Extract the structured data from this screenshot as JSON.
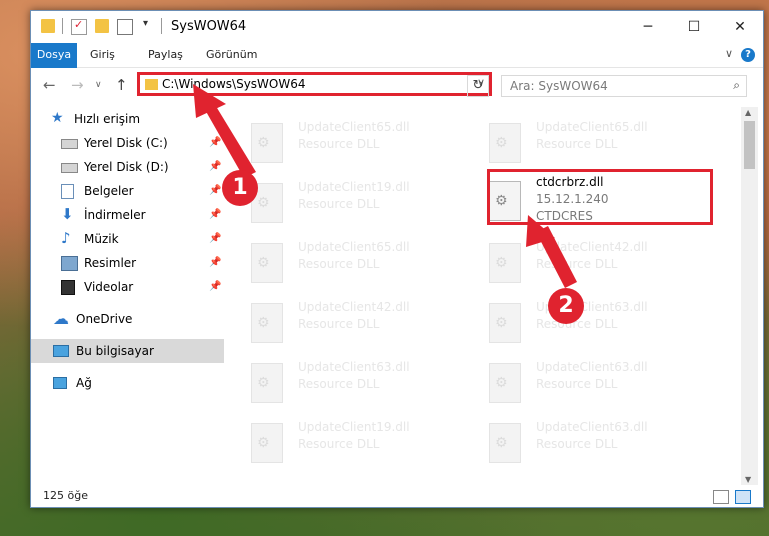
{
  "window": {
    "title": "SysWOW64"
  },
  "ribbon": {
    "tabs": [
      "Dosya",
      "Giriş",
      "Paylaş",
      "Görünüm"
    ],
    "help": "?"
  },
  "nav": {
    "address": "C:\\Windows\\SysWOW64",
    "search_placeholder": "Ara: SysWOW64"
  },
  "sidebar": {
    "quick_access": "Hızlı erişim",
    "items": [
      {
        "label": "Yerel Disk (C:)",
        "icon": "drive-icon"
      },
      {
        "label": "Yerel Disk (D:)",
        "icon": "drive-icon"
      },
      {
        "label": "Belgeler",
        "icon": "documents-icon"
      },
      {
        "label": "İndirmeler",
        "icon": "downloads-icon"
      },
      {
        "label": "Müzik",
        "icon": "music-icon"
      },
      {
        "label": "Resimler",
        "icon": "pictures-icon"
      },
      {
        "label": "Videolar",
        "icon": "videos-icon"
      }
    ],
    "onedrive": "OneDrive",
    "this_pc": "Bu bilgisayar",
    "network": "Ağ"
  },
  "files": {
    "left": [
      {
        "name": "UpdateClient65.dll",
        "desc": "Resource DLL"
      },
      {
        "name": "UpdateClient19.dll",
        "desc": "Resource DLL"
      },
      {
        "name": "UpdateClient65.dll",
        "desc": "Resource DLL"
      },
      {
        "name": "UpdateClient42.dll",
        "desc": "Resource DLL"
      },
      {
        "name": "UpdateClient63.dll",
        "desc": "Resource DLL"
      },
      {
        "name": "UpdateClient19.dll",
        "desc": "Resource DLL"
      }
    ],
    "right_top": {
      "name": "UpdateClient65.dll",
      "desc": "Resource DLL"
    },
    "highlight": {
      "name": "ctdcrbrz.dll",
      "version": "15.12.1.240",
      "company": "CTDCRES"
    },
    "right": [
      {
        "name": "UpdateClient42.dll",
        "desc": "Resource DLL"
      },
      {
        "name": "UpdateClient63.dll",
        "desc": "Resource DLL"
      },
      {
        "name": "UpdateClient63.dll",
        "desc": "Resource DLL"
      },
      {
        "name": "UpdateClient63.dll",
        "desc": "Resource DLL"
      }
    ]
  },
  "status": {
    "count": "125 öğe"
  },
  "callouts": {
    "one": "1",
    "two": "2"
  },
  "colors": {
    "accent": "#1979ca",
    "highlight_red": "#e0232f"
  }
}
